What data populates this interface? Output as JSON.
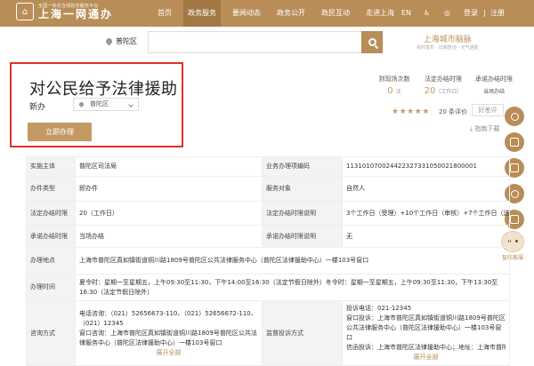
{
  "header": {
    "logo_sub": "全国一体化在线政务服务平台",
    "logo_main": "上海一网通办",
    "nav": [
      "首页",
      "政务服务",
      "要闻动态",
      "政务公开",
      "政民互动",
      "走进上海"
    ],
    "lang": "EN",
    "login": "登录",
    "divider": "|",
    "register": "注册"
  },
  "search": {
    "location": "普陀区",
    "placeholder": ""
  },
  "brain": {
    "title": "上海城市脑脉",
    "sub": "实时发布 · 日期查询 · 天气通报"
  },
  "service": {
    "title": "对公民给予法律援助",
    "type": "新办",
    "district": "普陀区",
    "apply_label": "立即办理"
  },
  "stats": [
    {
      "label": "到现场次数",
      "value": "0",
      "unit": "次"
    },
    {
      "label": "法定办结时限",
      "value": "20",
      "unit": "（工作日）"
    },
    {
      "label": "承诺办结时限",
      "value": "",
      "unit": "当场办结"
    }
  ],
  "rating": {
    "stars": "★★★★★",
    "reviews": "20 条评价",
    "review_btn": "好差评",
    "guide": "指南下载"
  },
  "assistant": {
    "label": "智能客服"
  },
  "detail": {
    "r1": {
      "k1": "实施主体",
      "v1": "普陀区司法局",
      "k2": "业务办理项编码",
      "v2": "11310107002442232733105002180000​1"
    },
    "r2": {
      "k1": "办件类型",
      "v1": "即办件",
      "k2": "服务对象",
      "v2": "自然人"
    },
    "r3": {
      "k1": "法定办结时限",
      "v1": "20（工作日）",
      "k2": "法定办结时限说明",
      "v2": "3个工作日（受理）+10个工作日（审核）+7个工作日（送达）"
    },
    "r4": {
      "k1": "承诺办结时限",
      "v1": "当场办结",
      "k2": "承诺办结时限说明",
      "v2": "无"
    },
    "r5": {
      "k1": "办理地点",
      "v1": "上海市普陀区真如镇街道铜川路1809号普陀区公共法律服务中心（普陀区法律援助中心）一楼103号窗口"
    },
    "r6": {
      "k1": "办理时间",
      "v1": "夏令时：星期一至星期五，上午09:30至11:30，下午14:00至16:30（法定节假日除外）冬令时：星期一至星期五，上午09:30至11:30，下午13:30至16:30（法定节假日除外）"
    },
    "r7": {
      "k1": "咨询方式",
      "v1_a": "电话咨询：（021）52656673-110、（021）52656672-110、（021）12345",
      "v1_b": "窗口咨询：上海市普陀区真如镇街道铜川路1809号普陀区公共法律服务中心（普陀区法律援助中心）一楼103号窗口",
      "v1_more": "展开全部",
      "k2": "监督投诉方式",
      "v2_a": "投诉电话：021-12345",
      "v2_b": "窗口投诉：上海市普陀区真如镇街道铜川路1809号普陀区公共法律服务中心（普陀区法律援助中心）一楼103号窗口",
      "v2_c": "信函投诉：上海市普陀区法律援助中心；地址：上海市普陀...",
      "v2_more": "展开全部"
    }
  },
  "colors": {
    "brand": "#b98d57",
    "accent": "#c49a64",
    "highlight": "#e0302d"
  }
}
